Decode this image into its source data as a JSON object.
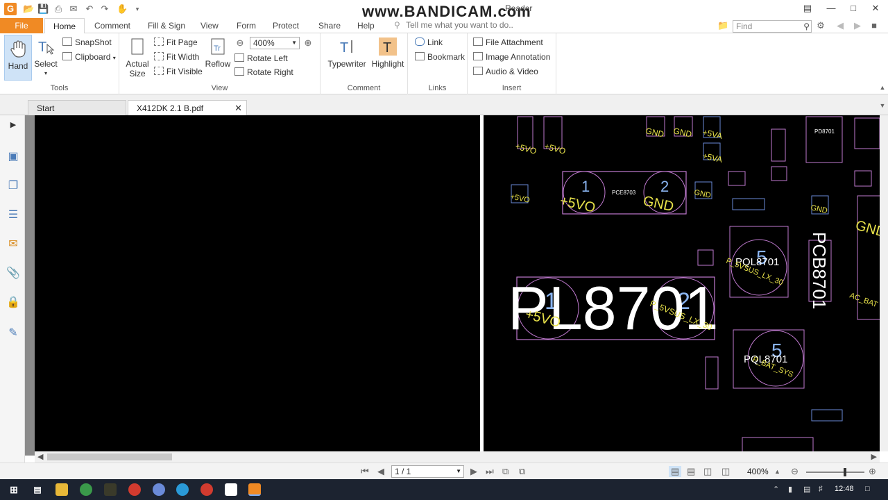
{
  "window": {
    "title_partial": "Reader",
    "watermark": "www.BANDICAM.com",
    "app_logo": "G"
  },
  "ribbon_tabs": [
    "File",
    "Home",
    "Comment",
    "Fill & Sign",
    "View",
    "Form",
    "Protect",
    "Share",
    "Help"
  ],
  "tell_me_placeholder": "Tell me what you want to do..",
  "find_placeholder": "Find",
  "tools_group": {
    "label": "Tools",
    "hand": "Hand",
    "select": "Select",
    "snapshot": "SnapShot",
    "clipboard": "Clipboard"
  },
  "view_group": {
    "label": "View",
    "actual_size_line1": "Actual",
    "actual_size_line2": "Size",
    "fit_page": "Fit Page",
    "fit_width": "Fit Width",
    "fit_visible": "Fit Visible",
    "reflow": "Reflow",
    "zoom_value": "400%",
    "rotate_left": "Rotate Left",
    "rotate_right": "Rotate Right"
  },
  "comment_group": {
    "label": "Comment",
    "typewriter": "Typewriter",
    "highlight": "Highlight"
  },
  "links_group": {
    "label": "Links",
    "link": "Link",
    "bookmark": "Bookmark"
  },
  "insert_group": {
    "label": "Insert",
    "file_attachment": "File Attachment",
    "image_annotation": "Image Annotation",
    "audio_video": "Audio & Video"
  },
  "doc_tabs": [
    "Start",
    "X412DK 2.1 B.pdf"
  ],
  "pcb": {
    "big_label": "PL8701",
    "pql8701": "PQL8701",
    "pql8702": "PQL8701",
    "pce8703": "PCE8703",
    "pd8701": "PD8701",
    "pcb_rotated": "PCB8701",
    "pin1": "1",
    "pin2": "2",
    "pin5": "5",
    "net_5vo": "+5VO",
    "net_gnd": "GND",
    "net_5va": "+5VA",
    "net_5vsus_lx": "P_5VSUS_LX_30",
    "net_bat_sys": "P_BAT_SYS",
    "net_ac_bat": "AC_BAT"
  },
  "status": {
    "page": "1 / 1",
    "zoom": "400%"
  },
  "taskbar": {
    "clock": "12:48"
  }
}
